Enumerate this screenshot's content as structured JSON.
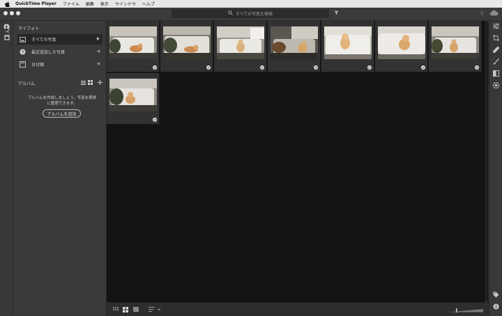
{
  "menubar": {
    "app_name": "QuickTime Player",
    "items": [
      "ファイル",
      "編集",
      "表示",
      "ウインドウ",
      "ヘルプ"
    ]
  },
  "search": {
    "placeholder": "すべての写真を検索"
  },
  "sidebar": {
    "my_photos_title": "マイフォト",
    "items": [
      {
        "label": "すべての写真",
        "active": true,
        "icon": "photo-icon"
      },
      {
        "label": "最近追加した写真",
        "active": false,
        "icon": "clock-icon"
      },
      {
        "label": "日付順",
        "active": false,
        "icon": "calendar-icon"
      }
    ],
    "albums_title": "アルバム",
    "album_message": "アルバムを作成しましょう。写真を簡単に整理できます。",
    "add_album_label": "アルバムを追加"
  },
  "photos": [
    {
      "icon": "cloud-synced-icon"
    },
    {
      "icon": "cloud-synced-icon"
    },
    {
      "icon": "cloud-synced-icon"
    },
    {
      "icon": "cloud-synced-icon"
    },
    {
      "icon": "cloud-synced-icon"
    },
    {
      "icon": "cloud-synced-icon"
    },
    {
      "icon": "cloud-synced-icon"
    },
    {
      "icon": "cloud-synced-icon"
    }
  ],
  "colors": {
    "panel_bg": "#3a3a3a",
    "grid_bg": "#131313",
    "cell_bg": "#323232",
    "accent": "#dedede"
  }
}
